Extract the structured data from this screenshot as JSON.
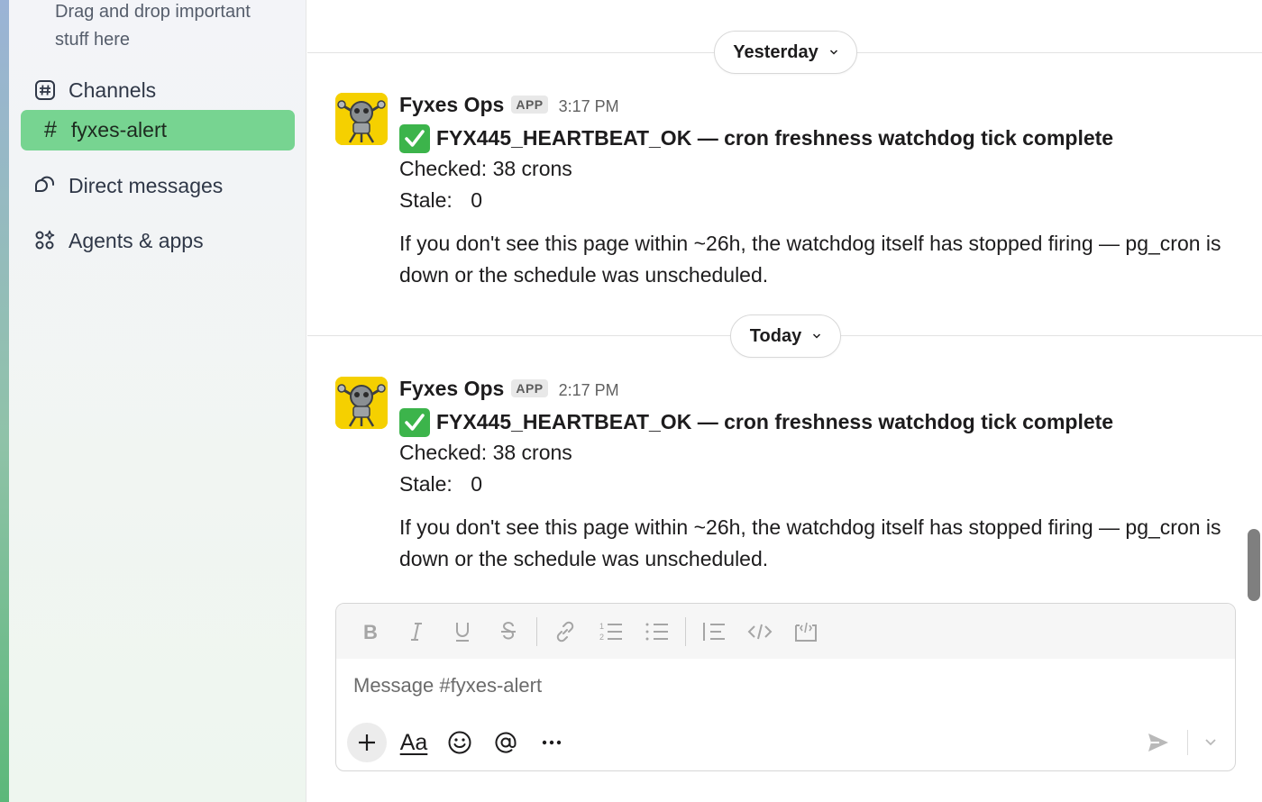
{
  "sidebar": {
    "drag_hint": "Drag and drop important stuff here",
    "channels_label": "Channels",
    "active_channel": "fyxes-alert",
    "direct_messages_label": "Direct messages",
    "agents_label": "Agents & apps"
  },
  "dividers": {
    "yesterday": "Yesterday",
    "today": "Today"
  },
  "messages": [
    {
      "sender": "Fyxes Ops",
      "badge": "APP",
      "time": "3:17 PM",
      "headline": "FYX445_HEARTBEAT_OK — cron freshness watchdog tick complete",
      "checked_label": "Checked:",
      "checked_value": "38 crons",
      "stale_label": "Stale:",
      "stale_value": "0",
      "note": "If you don't see this page within ~26h, the watchdog itself has stopped firing — pg_cron is down or the schedule was unscheduled."
    },
    {
      "sender": "Fyxes Ops",
      "badge": "APP",
      "time": "2:17 PM",
      "headline": "FYX445_HEARTBEAT_OK — cron freshness watchdog tick complete",
      "checked_label": "Checked:",
      "checked_value": "38 crons",
      "stale_label": "Stale:",
      "stale_value": "0",
      "note": "If you don't see this page within ~26h, the watchdog itself has stopped firing — pg_cron is down or the schedule was unscheduled."
    }
  ],
  "composer": {
    "placeholder": "Message #fyxes-alert",
    "aa_label": "Aa"
  },
  "colors": {
    "active_channel_bg": "#77d491",
    "check_green": "#3cb44b",
    "avatar_bg": "#f5d000"
  }
}
